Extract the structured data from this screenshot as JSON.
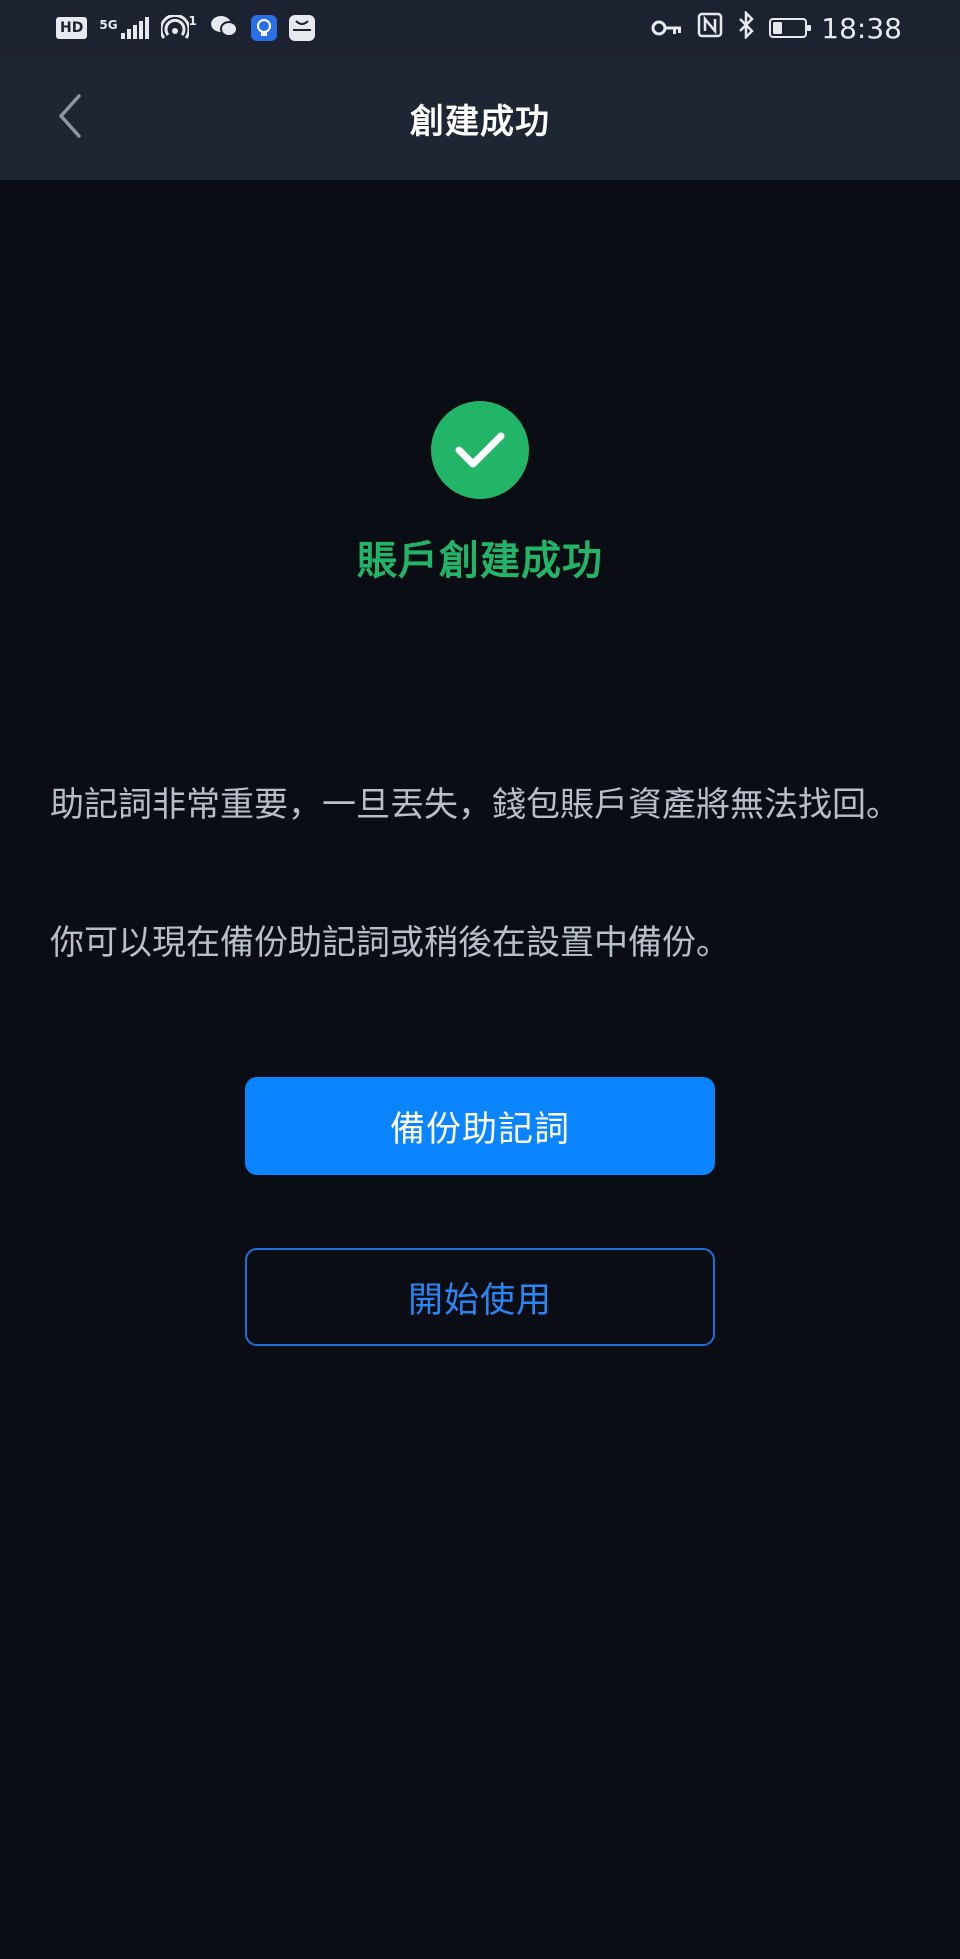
{
  "status_bar": {
    "hd_label": "HD",
    "network_label": "5G",
    "wifi_badge": "1",
    "app_icons": [
      "wechat-icon",
      "bulb-app-icon",
      "huawei-app-icon"
    ],
    "time": "18:38",
    "battery_level": 0.3
  },
  "header": {
    "title": "創建成功",
    "back_icon": "chevron-left-icon"
  },
  "success": {
    "icon": "check-circle-icon",
    "title": "賬戶創建成功"
  },
  "messages": {
    "warning": "助記詞非常重要，一旦丟失，錢包賬戶資產將無法找回。",
    "hint": "你可以現在備份助記詞或稍後在設置中備份。"
  },
  "actions": {
    "backup_label": "備份助記詞",
    "start_label": "開始使用"
  },
  "colors": {
    "success_green": "#22b467",
    "primary_blue": "#0a84ff",
    "background": "#0a0d13"
  }
}
